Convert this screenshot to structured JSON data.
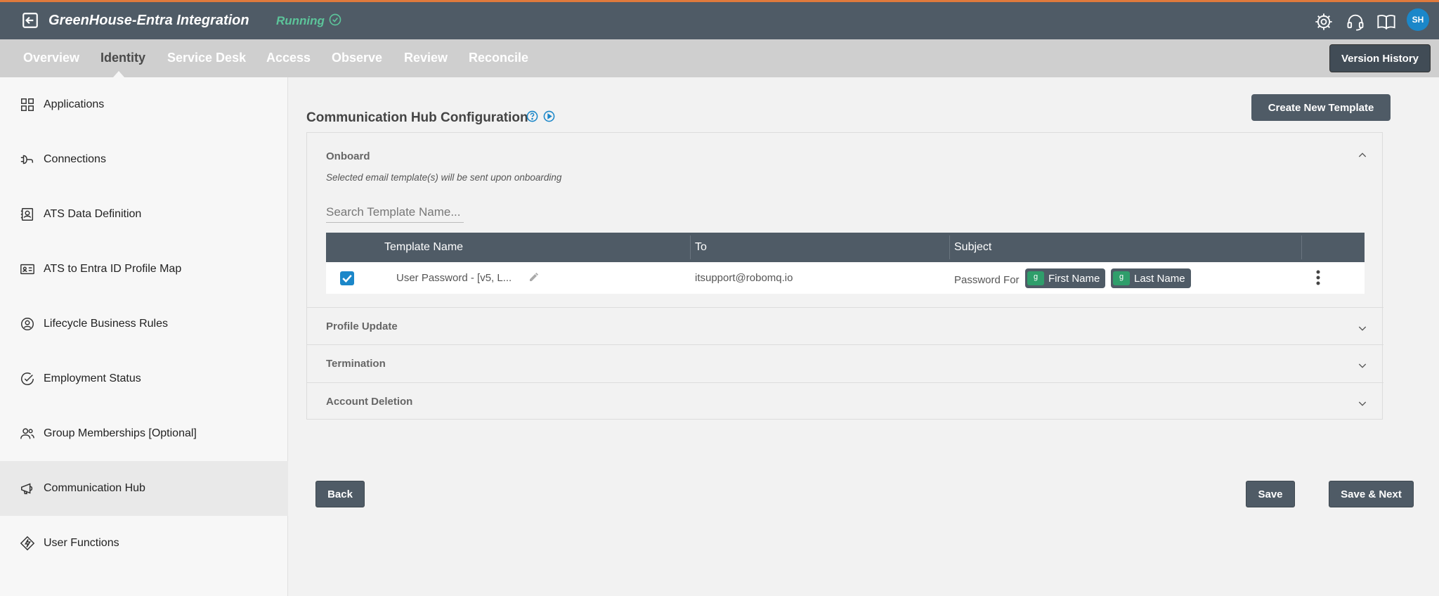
{
  "header": {
    "app_title": "GreenHouse-Entra Integration",
    "status": "Running",
    "avatar_initials": "SH",
    "accent_color": "#e07a3c",
    "status_color": "#5cc49a"
  },
  "nav": {
    "tabs": [
      {
        "label": "Overview"
      },
      {
        "label": "Identity",
        "active": true
      },
      {
        "label": "Service Desk"
      },
      {
        "label": "Access"
      },
      {
        "label": "Observe"
      },
      {
        "label": "Review"
      },
      {
        "label": "Reconcile"
      }
    ],
    "version_history_label": "Version History"
  },
  "sidebar": {
    "items": [
      {
        "label": "Applications",
        "icon": "grid-icon"
      },
      {
        "label": "Connections",
        "icon": "plug-icon"
      },
      {
        "label": "ATS Data Definition",
        "icon": "contact-book-icon"
      },
      {
        "label": "ATS to Entra ID Profile Map",
        "icon": "id-card-icon"
      },
      {
        "label": "Lifecycle Business Rules",
        "icon": "user-circle-icon"
      },
      {
        "label": "Employment Status",
        "icon": "check-circle-icon"
      },
      {
        "label": "Group Memberships [Optional]",
        "icon": "users-icon"
      },
      {
        "label": "Communication Hub",
        "icon": "megaphone-icon",
        "active": true
      },
      {
        "label": "User Functions",
        "icon": "bolt-diamond-icon"
      }
    ]
  },
  "main": {
    "title": "Communication Hub Configuration",
    "create_template_label": "Create New Template",
    "sections": {
      "onboard": {
        "title": "Onboard",
        "description": "Selected email template(s) will be sent upon onboarding",
        "search_placeholder": "Search Template Name...",
        "columns": [
          "Template Name",
          "To",
          "Subject"
        ],
        "rows": [
          {
            "checked": true,
            "template_name": "User Password - [v5, L...",
            "to": "itsupport@robomq.io",
            "subject_prefix": "Password For",
            "subject_chips": [
              "First Name",
              "Last Name"
            ]
          }
        ]
      },
      "profile_update": {
        "title": "Profile Update"
      },
      "termination": {
        "title": "Termination"
      },
      "account_deletion": {
        "title": "Account Deletion"
      }
    },
    "back_label": "Back",
    "save_label": "Save",
    "save_next_label": "Save & Next"
  }
}
